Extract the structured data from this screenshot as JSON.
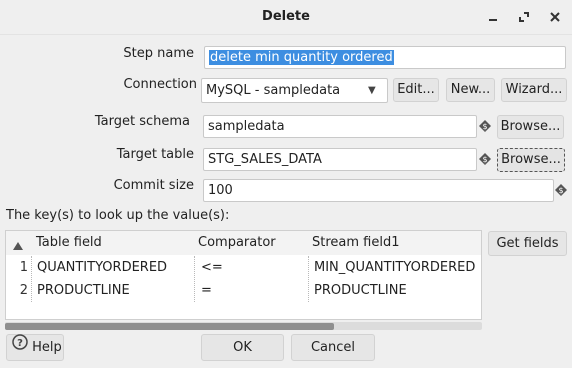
{
  "window": {
    "title": "Delete",
    "controls": [
      "minimize-icon",
      "maximize-icon",
      "close-icon"
    ]
  },
  "form": {
    "step_name_label": "Step name",
    "step_name_value": "delete min quantity ordered",
    "connection_label": "Connection",
    "connection_value": "MySQL - sampledata",
    "edit_label": "Edit...",
    "new_label": "New...",
    "wizard_label": "Wizard...",
    "target_schema_label": "Target schema",
    "target_schema_value": "sampledata",
    "target_table_label": "Target table",
    "target_table_value": "STG_SALES_DATA",
    "browse_label": "Browse...",
    "commit_size_label": "Commit size",
    "commit_size_value": "100"
  },
  "keys": {
    "section_label": "The key(s) to look up the value(s):",
    "get_fields_label": "Get fields",
    "columns": [
      "Table field",
      "Comparator",
      "Stream field1"
    ],
    "rows": [
      {
        "num": "1",
        "table_field": "QUANTITYORDERED",
        "comparator": "<=",
        "stream_field": "MIN_QUANTITYORDERED"
      },
      {
        "num": "2",
        "table_field": "PRODUCTLINE",
        "comparator": "=",
        "stream_field": "PRODUCTLINE"
      }
    ]
  },
  "footer": {
    "help_label": "Help",
    "ok_label": "OK",
    "cancel_label": "Cancel"
  }
}
